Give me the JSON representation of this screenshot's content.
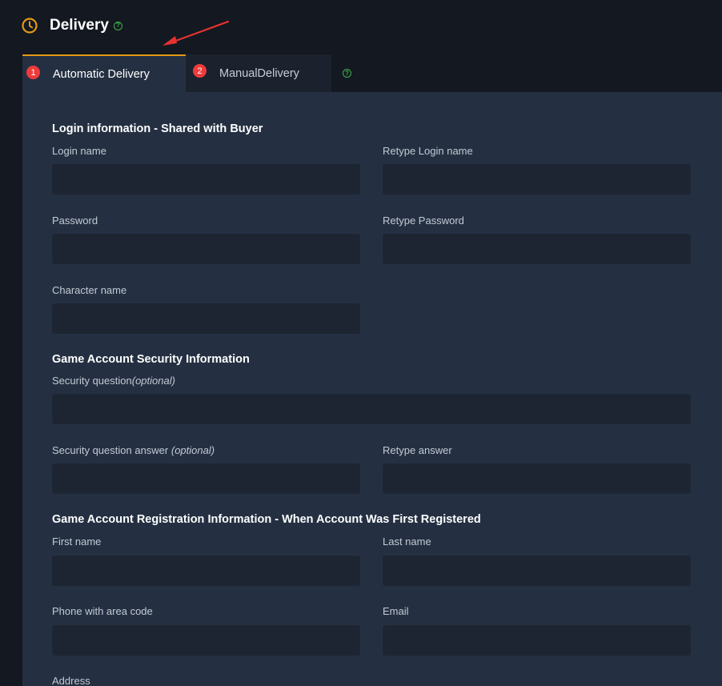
{
  "header": {
    "title": "Delivery",
    "help_glyph": "?",
    "icon": "clock-icon",
    "accent_color": "#e39a12",
    "help_color": "#3fb24a"
  },
  "tabs": [
    {
      "badge": "1",
      "label": "Automatic Delivery",
      "active": true
    },
    {
      "badge": "2",
      "label": "ManualDelivery",
      "active": false
    }
  ],
  "tab_help_glyph": "?",
  "sections": {
    "login": {
      "title": "Login information - Shared with Buyer",
      "login_name": "Login name",
      "retype_login_name": "Retype Login name",
      "password": "Password",
      "retype_password": "Retype Password",
      "character_name": "Character name"
    },
    "security": {
      "title": "Game Account Security Information",
      "security_question": "Security question",
      "security_question_optional": "(optional)",
      "security_answer": "Security question answer",
      "security_answer_optional": "(optional)",
      "retype_answer": "Retype answer"
    },
    "registration": {
      "title": "Game Account Registration Information - When Account Was First Registered",
      "first_name": "First name",
      "last_name": "Last name",
      "phone": "Phone with area code",
      "email": "Email",
      "address": "Address"
    }
  },
  "fields": {
    "login_name": "",
    "retype_login_name": "",
    "password": "",
    "retype_password": "",
    "character_name": "",
    "security_question": "",
    "security_answer": "",
    "retype_answer": "",
    "first_name": "",
    "last_name": "",
    "phone": "",
    "email": ""
  },
  "badge_color": "#ee3b3b"
}
